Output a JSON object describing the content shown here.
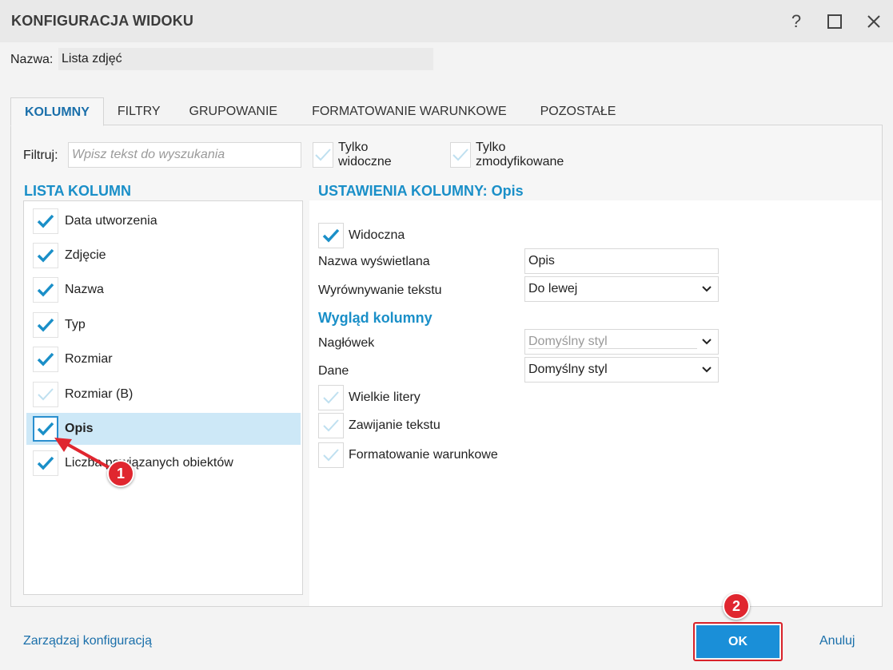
{
  "window": {
    "title": "KONFIGURACJA WIDOKU",
    "help_glyph": "?",
    "maximize_glyph": "☐",
    "close_glyph": "✕"
  },
  "name_row": {
    "label": "Nazwa:",
    "value": "Lista zdjęć"
  },
  "tabs": [
    {
      "label": "KOLUMNY",
      "active": true
    },
    {
      "label": "FILTRY"
    },
    {
      "label": "GRUPOWANIE"
    },
    {
      "label": "FORMATOWANIE WARUNKOWE"
    },
    {
      "label": "POZOSTAŁE"
    }
  ],
  "filter": {
    "label": "Filtruj:",
    "placeholder": "Wpisz tekst do wyszukania",
    "only_visible": "Tylko widoczne",
    "only_modified": "Tylko zmodyfikowane"
  },
  "column_list": {
    "heading": "LISTA KOLUMN",
    "items": [
      {
        "label": "Data utworzenia",
        "checked": true
      },
      {
        "label": "Zdjęcie",
        "checked": true
      },
      {
        "label": "Nazwa",
        "checked": true
      },
      {
        "label": "Typ",
        "checked": true
      },
      {
        "label": "Rozmiar",
        "checked": true
      },
      {
        "label": "Rozmiar (B)",
        "checked": false
      },
      {
        "label": "Opis",
        "checked": true,
        "selected": true
      },
      {
        "label": "Liczba powiązanych obiektów",
        "checked": true
      }
    ]
  },
  "settings": {
    "heading": "USTAWIENIA KOLUMNY: Opis",
    "visible_label": "Widoczna",
    "display_name_label": "Nazwa wyświetlana",
    "display_name_value": "Opis",
    "alignment_label": "Wyrównywanie tekstu",
    "alignment_value": "Do lewej",
    "appearance_heading": "Wygląd kolumny",
    "header_label": "Nagłówek",
    "header_value": "Domyślny styl",
    "data_label": "Dane",
    "data_value": "Domyślny styl",
    "uppercase_label": "Wielkie litery",
    "wrap_label": "Zawijanie tekstu",
    "conditional_label": "Formatowanie warunkowe"
  },
  "footer": {
    "manage_link": "Zarządzaj konfiguracją",
    "ok_label": "OK",
    "cancel_label": "Anuluj"
  },
  "annotations": {
    "badge_1": "1",
    "badge_2": "2"
  },
  "colors": {
    "accent": "#1a8fc8",
    "link": "#1a6faa",
    "ok_button": "#1a8fd8",
    "selected_row": "#cde8f7",
    "annotation_red": "#e0262f"
  }
}
